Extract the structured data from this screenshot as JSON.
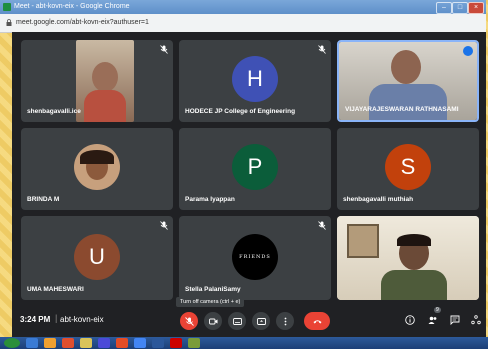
{
  "browser": {
    "window_title": "Meet - abt-kovn-eix - Google Chrome",
    "url": "meet.google.com/abt-kovn-eix?authuser=1"
  },
  "tiles": [
    {
      "name": "shenbagavalli.ice",
      "type": "video"
    },
    {
      "name": "HODECE JP College of Engineering",
      "type": "avatar",
      "initial": "H",
      "color": "#3f51b5"
    },
    {
      "name": "VIJAYARAJESWARAN RATHNASAMI",
      "type": "video"
    },
    {
      "name": "BRINDA M",
      "type": "photo"
    },
    {
      "name": "Parama Iyappan",
      "type": "avatar",
      "initial": "P",
      "color": "#0b5d3a"
    },
    {
      "name": "shenbagavalli muthiah",
      "type": "avatar",
      "initial": "S",
      "color": "#c2410c"
    },
    {
      "name": "UMA MAHESWARI",
      "type": "avatar",
      "initial": "U",
      "color": "#8b4a2f"
    },
    {
      "name": "Stella PalaniSamy",
      "type": "logo",
      "logo_text": "FRIENDS"
    },
    {
      "name": "",
      "type": "video"
    }
  ],
  "meeting": {
    "time": "3:24 PM",
    "code": "abt-kovn-eix",
    "tooltip": "Turn off camera (ctrl + e)",
    "people_badge": "9"
  },
  "colors": {
    "meet_bg": "#202124",
    "tile_bg": "#3c4043",
    "end_call": "#ea4335",
    "mic_off": "#ea4335"
  }
}
